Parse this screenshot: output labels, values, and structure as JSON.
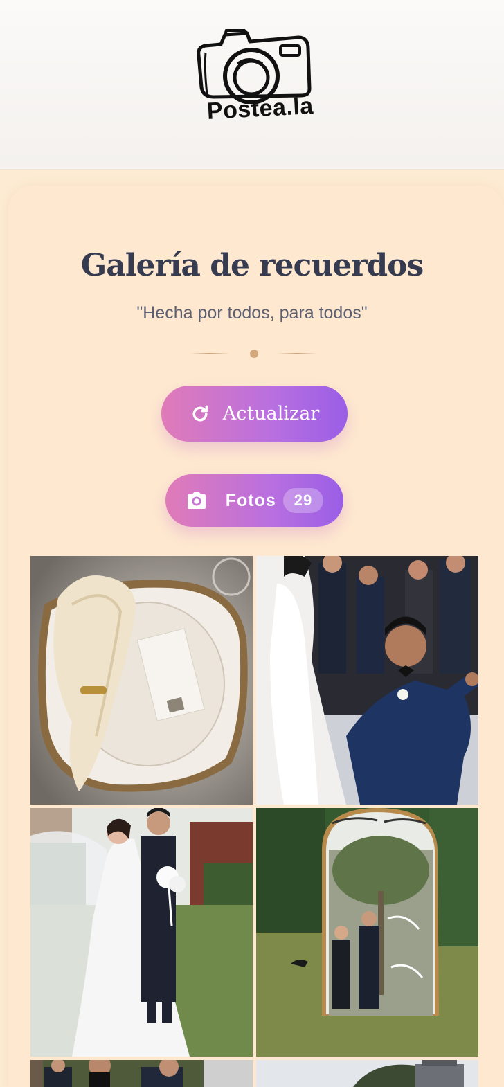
{
  "header": {
    "logo_text": "Postea.la",
    "logo_icon": "camera-icon"
  },
  "gallery": {
    "title": "Galería de recuerdos",
    "subtitle": "\"Hecha por todos, para todos\""
  },
  "actions": {
    "refresh_label": "Actualizar",
    "refresh_icon": "refresh-icon",
    "photos_label": "Fotos",
    "photos_icon": "camera-icon",
    "photos_count": "29"
  },
  "photos": [
    {
      "subject": "table-setting"
    },
    {
      "subject": "proposal"
    },
    {
      "subject": "couple-garden"
    },
    {
      "subject": "welcome-sign"
    },
    {
      "subject": "guests"
    },
    {
      "subject": "venue"
    }
  ],
  "colors": {
    "background": "#fdebd3",
    "title": "#363b50",
    "accent_start": "#e07bb8",
    "accent_end": "#9a5ee6"
  }
}
